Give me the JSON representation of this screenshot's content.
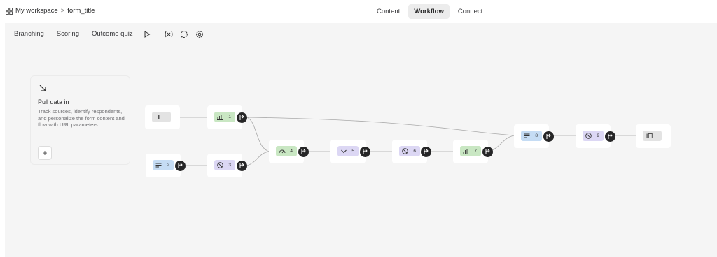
{
  "breadcrumb": {
    "workspace": "My workspace",
    "separator": ">",
    "form_title": "form_title"
  },
  "top_tabs": [
    {
      "label": "Content",
      "active": false
    },
    {
      "label": "Workflow",
      "active": true
    },
    {
      "label": "Connect",
      "active": false
    }
  ],
  "subtoolbar": {
    "items": [
      "Branching",
      "Scoring",
      "Outcome quiz"
    ],
    "tools": [
      "play-icon",
      "variable-icon",
      "comment-icon",
      "settings-icon"
    ]
  },
  "pull_card": {
    "title": "Pull data in",
    "description": "Track sources, identify respondents, and personalize the form content and flow with URL parameters.",
    "add_label": "+"
  },
  "nodes": [
    {
      "id": "start",
      "label": "",
      "icon": "welcome-screen-icon",
      "color": "gray"
    },
    {
      "id": "n1",
      "label": "1",
      "icon": "rating-icon",
      "color": "green"
    },
    {
      "id": "n2",
      "label": "2",
      "icon": "text-icon",
      "color": "blue"
    },
    {
      "id": "n3",
      "label": "3",
      "icon": "block-icon",
      "color": "purple"
    },
    {
      "id": "n4",
      "label": "4",
      "icon": "gauge-icon",
      "color": "green"
    },
    {
      "id": "n5",
      "label": "5",
      "icon": "dropdown-icon",
      "color": "purple"
    },
    {
      "id": "n6",
      "label": "6",
      "icon": "block-icon",
      "color": "purple"
    },
    {
      "id": "n7",
      "label": "7",
      "icon": "rating-icon",
      "color": "green"
    },
    {
      "id": "n8",
      "label": "8",
      "icon": "text-icon",
      "color": "blue"
    },
    {
      "id": "n9",
      "label": "9",
      "icon": "block-icon",
      "color": "purple"
    },
    {
      "id": "end",
      "label": "",
      "icon": "end-screen-icon",
      "color": "gray"
    }
  ],
  "colors": {
    "green": "#c9e7c3",
    "blue": "#c5dcf4",
    "purple": "#dcd7f4",
    "gray": "#e3e3e3",
    "branch": "#262627"
  }
}
